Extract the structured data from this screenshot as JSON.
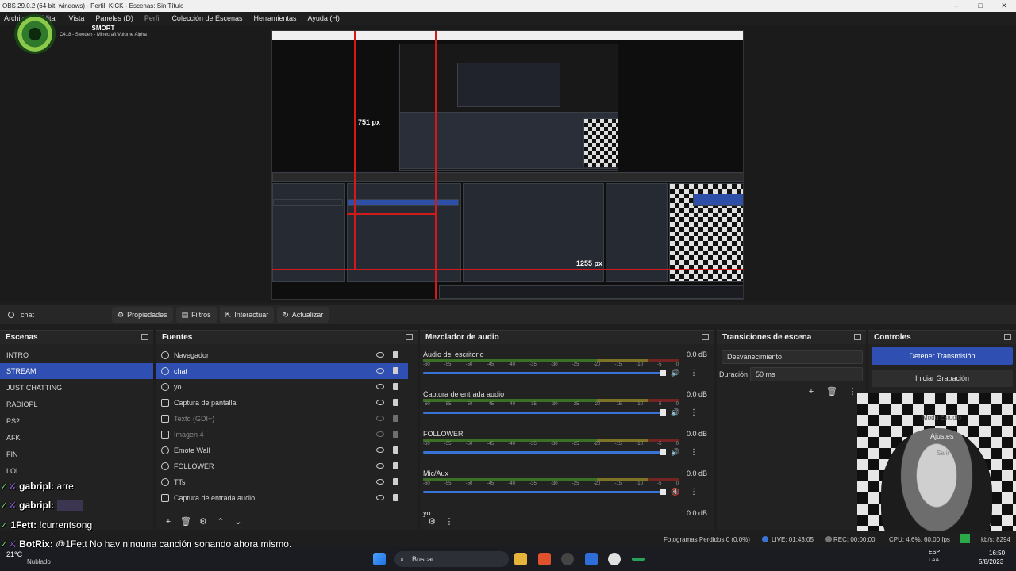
{
  "window": {
    "title": "OBS 29.0.2 (64-bit, windows) - Perfil: KICK - Escenas: Sin Título"
  },
  "menu": [
    "Archivo",
    "Editar",
    "Vista",
    "Paneles (D)",
    "Perfil",
    "Colección de Escenas",
    "Herramientas",
    "Ayuda (H)"
  ],
  "overlay": {
    "logo_title": "SMORT",
    "logo_sub": "C418 - Sweden - Minecraft Volume Alpha"
  },
  "preview": {
    "label_height": "751 px",
    "label_width": "1255 px"
  },
  "source_bar": {
    "current": "chat",
    "buttons": [
      "Propiedades",
      "Filtros",
      "Interactuar",
      "Actualizar"
    ]
  },
  "scenes": {
    "title": "Escenas",
    "items": [
      "INTRO",
      "STREAM",
      "JUST CHATTING",
      "RADIOPL",
      "PS2",
      "AFK",
      "FIN",
      "LOL"
    ],
    "selected_index": 1
  },
  "sources": {
    "title": "Fuentes",
    "items": [
      {
        "label": "Navegador",
        "icon": "globe-icon",
        "dim": false
      },
      {
        "label": "chat",
        "icon": "globe-icon",
        "dim": false
      },
      {
        "label": "yo",
        "icon": "globe-icon",
        "dim": false
      },
      {
        "label": "Captura de pantalla",
        "icon": "monitor-icon",
        "dim": false
      },
      {
        "label": "Texto (GDI+)",
        "icon": "text-icon",
        "dim": true
      },
      {
        "label": "Imagen 4",
        "icon": "image-icon",
        "dim": true
      },
      {
        "label": "Emote Wall",
        "icon": "globe-icon",
        "dim": false
      },
      {
        "label": "FOLLOWER",
        "icon": "globe-icon",
        "dim": false
      },
      {
        "label": "TTs",
        "icon": "globe-icon",
        "dim": false
      },
      {
        "label": "Captura de entrada audio",
        "icon": "mic-icon",
        "dim": false
      }
    ],
    "selected_index": 1
  },
  "mixer": {
    "title": "Mezclador de audio",
    "ticks": [
      "-60",
      "-55",
      "-50",
      "-45",
      "-40",
      "-35",
      "-30",
      "-25",
      "-20",
      "-15",
      "-10",
      "-5",
      "0"
    ],
    "channels": [
      {
        "name": "Audio del escritorio",
        "db": "0.0 dB",
        "muted": false
      },
      {
        "name": "Captura de entrada audio",
        "db": "0.0 dB",
        "muted": false
      },
      {
        "name": "FOLLOWER",
        "db": "0.0 dB",
        "muted": false
      },
      {
        "name": "Mic/Aux",
        "db": "0.0 dB",
        "muted": true
      },
      {
        "name": "yo",
        "db": "0.0 dB",
        "muted": false
      }
    ]
  },
  "transitions": {
    "title": "Transiciones de escena",
    "selected": "Desvanecimiento",
    "duration_label": "Duración",
    "duration_value": "50 ms"
  },
  "controls": {
    "title": "Controles",
    "buttons": [
      "Detener Transmisión",
      "Iniciar Grabación",
      "Modo Estudio",
      "Ajustes",
      "Salir"
    ]
  },
  "status": {
    "dropped": "Fotogramas Perdidos 0 (0.0%)",
    "live": "LIVE: 01:43:05",
    "rec": "REC: 00:00:00",
    "cpu": "CPU: 4.6%, 60.00 fps",
    "kbps": "kb/s: 8294"
  },
  "chat": [
    {
      "user": "gabripl:",
      "msg": "arre"
    },
    {
      "user": "gabripl:",
      "msg": ""
    },
    {
      "user": "1Fett:",
      "msg": "!currentsong"
    },
    {
      "user": "BotRix:",
      "msg": "@1Fett No hay ninguna canción sonando ahora mismo."
    }
  ],
  "taskbar": {
    "weather_temp": "21°C",
    "weather_desc": "Nublado",
    "search": "Buscar",
    "lang": "ESP",
    "lang_sub": "LAA",
    "time": "16:50",
    "date": "5/8/2023"
  },
  "colors": {
    "accent": "#2f4fb2",
    "live_green": "#2aa84a",
    "red_guides": "#d21a1a"
  }
}
